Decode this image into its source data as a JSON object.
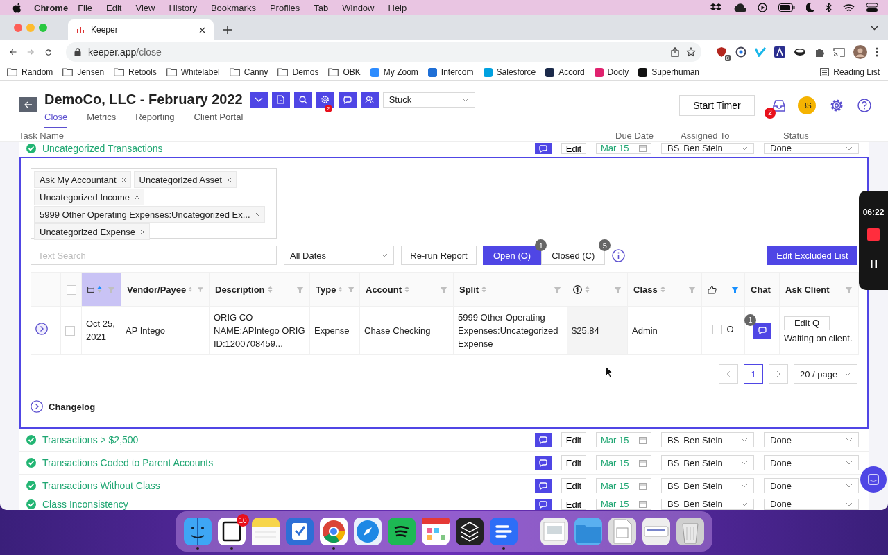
{
  "menu_bar": {
    "app": "Chrome",
    "items": [
      "File",
      "Edit",
      "View",
      "History",
      "Bookmarks",
      "Profiles",
      "Tab",
      "Window",
      "Help"
    ]
  },
  "browser": {
    "tab_title": "Keeper",
    "url_host": "keeper.app",
    "url_path": "/close",
    "extension_badge": "8",
    "reading_list": "Reading List",
    "bookmarks": [
      {
        "label": "Random",
        "kind": "folder"
      },
      {
        "label": "Jensen",
        "kind": "folder"
      },
      {
        "label": "Retools",
        "kind": "folder"
      },
      {
        "label": "Whitelabel",
        "kind": "folder"
      },
      {
        "label": "Canny",
        "kind": "folder"
      },
      {
        "label": "Demos",
        "kind": "folder"
      },
      {
        "label": "OBK",
        "kind": "folder"
      },
      {
        "label": "My Zoom",
        "kind": "site",
        "color": "#2d8cff"
      },
      {
        "label": "Intercom",
        "kind": "site",
        "color": "#1f6fd6"
      },
      {
        "label": "Salesforce",
        "kind": "site",
        "color": "#00a1e0"
      },
      {
        "label": "Accord",
        "kind": "site",
        "color": "#1b2a4a"
      },
      {
        "label": "Dooly",
        "kind": "site",
        "color": "#e0226e"
      },
      {
        "label": "Superhuman",
        "kind": "site",
        "color": "#111111"
      }
    ]
  },
  "header": {
    "title": "DemoCo, LLC - February 2022",
    "status_select": "Stuck",
    "start_timer": "Start Timer",
    "inbox_badge": "2",
    "avatar": "BS",
    "tool_buttons": [
      {
        "kind": "expand"
      },
      {
        "kind": "document"
      },
      {
        "kind": "search"
      },
      {
        "kind": "settings",
        "badge": "2"
      },
      {
        "kind": "chat"
      },
      {
        "kind": "users"
      }
    ],
    "tabs": [
      {
        "label": "Close",
        "selected": true
      },
      {
        "label": "Metrics",
        "selected": false
      },
      {
        "label": "Reporting",
        "selected": false
      },
      {
        "label": "Client Portal",
        "selected": false
      }
    ]
  },
  "task_columns": [
    "Task Name",
    "Due Date",
    "Assigned To",
    "Status"
  ],
  "expanded_task": {
    "name": "Uncategorized Transactions",
    "done": true,
    "edit": "Edit",
    "due": "Mar 15",
    "assignee": "Ben Stein",
    "initials": "BS",
    "status": "Done"
  },
  "filters": {
    "tags": [
      "Ask My Accountant",
      "Uncategorized Asset",
      "Uncategorized Income",
      "5999 Other Operating Expenses:Uncategorized Ex...",
      "Uncategorized Expense"
    ],
    "search_placeholder": "Text Search",
    "date_range": "All Dates",
    "rerun": "Re-run Report",
    "toggles": [
      {
        "label": "Open (O)",
        "count": "1",
        "selected": true
      },
      {
        "label": "Closed (C)",
        "count": "5",
        "selected": false
      }
    ],
    "edit_excluded": "Edit Excluded List"
  },
  "table": {
    "columns": [
      {
        "kind": "expand"
      },
      {
        "kind": "select",
        "checked": false
      },
      {
        "kind": "date",
        "sorted": true,
        "filter_active": false
      },
      {
        "kind": "text",
        "label": "Vendor/Payee",
        "sorted": false,
        "filter_active": false
      },
      {
        "kind": "text",
        "label": "Description",
        "sorted": false,
        "filter_active": false
      },
      {
        "kind": "text",
        "label": "Type",
        "sorted": false,
        "filter_active": false
      },
      {
        "kind": "text",
        "label": "Account",
        "sorted": false,
        "filter_active": false
      },
      {
        "kind": "text",
        "label": "Split",
        "sorted": false,
        "filter_active": false
      },
      {
        "kind": "amount",
        "sorted": false,
        "filter_active": false
      },
      {
        "kind": "text",
        "label": "Class",
        "sorted": false,
        "filter_active": false
      },
      {
        "kind": "approval",
        "filter_active": true
      },
      {
        "kind": "text",
        "label": "Chat"
      },
      {
        "kind": "text",
        "label": "Ask Client",
        "filter_active": false
      }
    ],
    "rows": [
      {
        "selected": false,
        "date": "Oct 25, 2021",
        "vendor": "AP Intego",
        "description": "ORIG CO NAME:APIntego ORIG ID:1200708459...",
        "type": "Expense",
        "account": "Chase Checking",
        "split": "5999 Other Operating Expenses:Uncategorized Expense",
        "amount": "$25.84",
        "class": "Admin",
        "approved": false,
        "approval_label": "O",
        "chat_count": "1",
        "ask_button": "Edit Q",
        "ask_status": "Waiting on client."
      }
    ]
  },
  "pagination": {
    "pages": [
      {
        "label": "1",
        "selected": true
      }
    ],
    "page_size": "20 / page"
  },
  "changelog": {
    "label": "Changelog",
    "expanded": false
  },
  "tasks": [
    {
      "name": "Transactions > $2,500",
      "done": true,
      "edit": "Edit",
      "due": "Mar 15",
      "assignee": "Ben Stein",
      "initials": "BS",
      "status": "Done"
    },
    {
      "name": "Transactions Coded to Parent Accounts",
      "done": true,
      "edit": "Edit",
      "due": "Mar 15",
      "assignee": "Ben Stein",
      "initials": "BS",
      "status": "Done"
    },
    {
      "name": "Transactions Without Class",
      "done": true,
      "edit": "Edit",
      "due": "Mar 15",
      "assignee": "Ben Stein",
      "initials": "BS",
      "status": "Done"
    },
    {
      "name": "Class Inconsistency",
      "done": true,
      "edit": "Edit",
      "due": "Mar 15",
      "assignee": "Ben Stein",
      "initials": "BS",
      "status": "Done"
    }
  ],
  "recorder": {
    "time": "06:22"
  },
  "dock": [
    {
      "kind": "finder",
      "running": true
    },
    {
      "kind": "notion",
      "running": true,
      "badge": "10"
    },
    {
      "kind": "notes"
    },
    {
      "kind": "tasks"
    },
    {
      "kind": "chrome",
      "running": true
    },
    {
      "kind": "safari"
    },
    {
      "kind": "spotify"
    },
    {
      "kind": "calendar"
    },
    {
      "kind": "cube"
    },
    {
      "kind": "lines",
      "running": true
    },
    {
      "kind": "separator"
    },
    {
      "kind": "document"
    },
    {
      "kind": "folder"
    },
    {
      "kind": "sheet"
    },
    {
      "kind": "scanner"
    },
    {
      "kind": "trash"
    }
  ]
}
